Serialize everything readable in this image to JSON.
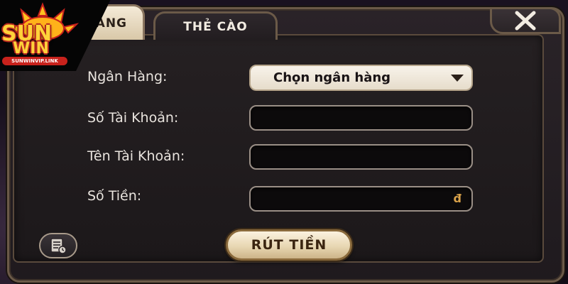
{
  "brand": {
    "logo_top": "SUN",
    "logo_bottom": "WIN",
    "logo_link": "SUNWINVIP.LINK"
  },
  "tabs": [
    {
      "label": "ÀNG",
      "active": true
    },
    {
      "label": "THẺ CÀO",
      "active": false
    }
  ],
  "form": {
    "bank_label": "Ngân Hàng:",
    "bank_select_value": "Chọn ngân hàng",
    "account_number_label": "Số Tài Khoản:",
    "account_number_value": "",
    "account_name_label": "Tên Tài Khoản:",
    "account_name_value": "",
    "amount_label": "Số Tiền:",
    "amount_value": "",
    "currency_symbol": "đ"
  },
  "actions": {
    "submit_label": "RÚT TIỀN"
  },
  "icons": {
    "close": "close-icon",
    "dropdown": "caret-down-icon",
    "history": "history-document-icon"
  },
  "colors": {
    "accent_gold": "#d9a24a",
    "button_cream": "#f4ead8",
    "panel_dark": "#1f1a1e"
  }
}
